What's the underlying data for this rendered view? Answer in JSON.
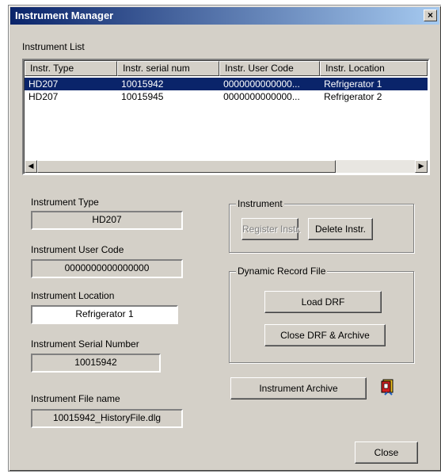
{
  "window": {
    "title": "Instrument Manager",
    "close_glyph": "×"
  },
  "list": {
    "label": "Instrument  List",
    "columns": [
      "Instr. Type",
      "Instr. serial num",
      "Instr. User Code",
      "Instr. Location"
    ],
    "rows": [
      {
        "type": "HD207",
        "serial": "10015942",
        "user_code": "0000000000000...",
        "location": "Refrigerator 1",
        "selected": true
      },
      {
        "type": "HD207",
        "serial": "10015945",
        "user_code": "0000000000000...",
        "location": "Refrigerator 2",
        "selected": false
      }
    ],
    "scroll_left_glyph": "◀",
    "scroll_right_glyph": "▶"
  },
  "fields": {
    "type_label": "Instrument Type",
    "type_value": "HD207",
    "user_code_label": "Instrument User Code",
    "user_code_value": "0000000000000000",
    "location_label": "Instrument Location",
    "location_value": "Refrigerator 1",
    "serial_label": "Instrument Serial Number",
    "serial_value": "10015942",
    "file_label": "Instrument File name",
    "file_value": "10015942_HistoryFile.dlg"
  },
  "instrument_group": {
    "title": "Instrument",
    "register_label": "Register Instr.",
    "delete_label": "Delete Instr."
  },
  "drf_group": {
    "title": "Dynamic Record File",
    "load_label": "Load DRF",
    "close_archive_label": "Close DRF & Archive"
  },
  "archive_label": "Instrument  Archive",
  "archive_icon": "archive-book-icon",
  "close_label": "Close",
  "colors": {
    "title_start": "#0a246a",
    "title_end": "#a6caf0",
    "selection": "#0a246a",
    "face": "#d4d0c8"
  }
}
